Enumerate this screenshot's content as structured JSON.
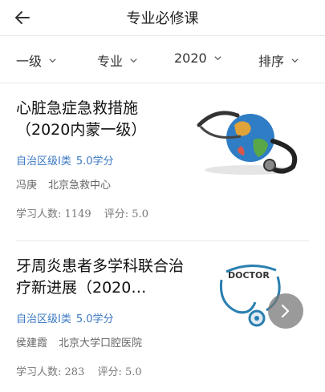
{
  "header": {
    "title": "专业必修课"
  },
  "filters": [
    {
      "label": "一级"
    },
    {
      "label": "专业"
    },
    {
      "label": "2020"
    },
    {
      "label": "排序"
    }
  ],
  "courses": [
    {
      "title": "心脏急症急救措施（2020内蒙一级）",
      "level": "自治区级I类",
      "credit": "5.0学分",
      "teacher": "冯庚",
      "org": "北京急救中心",
      "learners_label": "学习人数:",
      "learners": "1149",
      "score_label": "评分:",
      "score": "5.0"
    },
    {
      "title": "牙周炎患者多学科联合治疗新进展（2020…",
      "level": "自治区级I类",
      "credit": "5.0学分",
      "teacher": "侯建霞",
      "org": "北京大学口腔医院",
      "learners_label": "学习人数:",
      "learners": "283",
      "score_label": "评分:",
      "score": "5.0"
    }
  ],
  "thumb2_text": "DOCTOR",
  "colors": {
    "accent": "#3a78c4",
    "divider": "#e6e6e6"
  }
}
